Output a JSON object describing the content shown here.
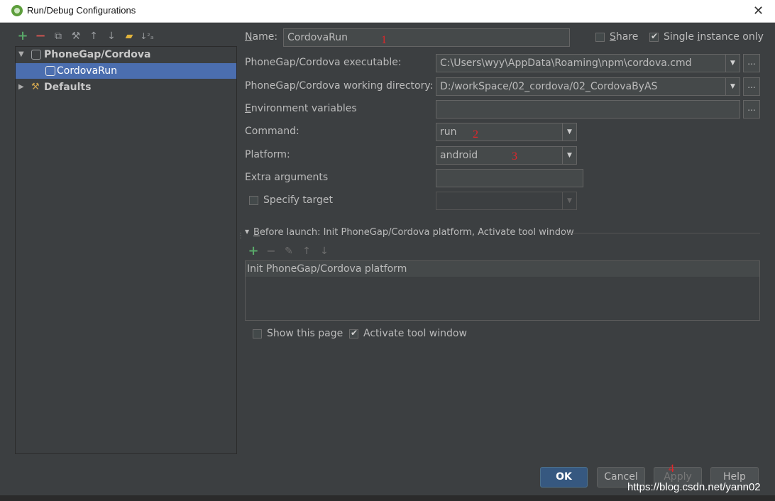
{
  "window": {
    "title": "Run/Debug Configurations"
  },
  "toolbar": {
    "add": "+",
    "remove": "−",
    "copy": "⧉",
    "edit_defaults": "⚒",
    "move_up": "↑",
    "move_down": "↓",
    "folder": "▰",
    "sort": "↓ᶻₐ"
  },
  "tree": {
    "group": "PhoneGap/Cordova",
    "selected_item": "CordovaRun",
    "defaults": "Defaults"
  },
  "form": {
    "name_label_u": "N",
    "name_label_rest": "ame:",
    "name_value": "CordovaRun",
    "share_label_u": "S",
    "share_label_rest": "hare",
    "single_label_a": "Single ",
    "single_label_u": "i",
    "single_label_rest": "nstance only",
    "exec_label": "PhoneGap/Cordova executable:",
    "exec_value": "C:\\Users\\wyy\\AppData\\Roaming\\npm\\cordova.cmd",
    "workdir_label": "PhoneGap/Cordova working directory:",
    "workdir_value": "D:/workSpace/02_cordova/02_CordovaByAS",
    "env_label_u": "E",
    "env_label_rest": "nvironment variables",
    "env_value": "",
    "command_label": "Command:",
    "command_value": "run",
    "platform_label": "Platform:",
    "platform_value": "android",
    "extra_label": "Extra arguments",
    "extra_value": "",
    "specify_target_label": "Specify target",
    "target_value": "",
    "dots": "..."
  },
  "before_launch": {
    "header_u": "B",
    "header_rest": "efore launch: Init PhoneGap/Cordova platform, Activate tool window",
    "add": "+",
    "remove": "−",
    "edit": "✎",
    "up": "↑",
    "down": "↓",
    "items": [
      "Init PhoneGap/Cordova platform"
    ],
    "show_page_label": "Show this page",
    "activate_label": "Activate tool window"
  },
  "annotations": {
    "one": "1",
    "two": "2",
    "three": "3",
    "four": "4"
  },
  "buttons": {
    "ok": "OK",
    "cancel": "Cancel",
    "apply": "Apply",
    "help": "Help"
  },
  "watermark": "https://blog.csdn.net/yann02",
  "colors": {
    "selection": "#4b6eaf",
    "ok_button": "#365880",
    "annotation": "#e0262a",
    "background": "#3c3f41"
  }
}
